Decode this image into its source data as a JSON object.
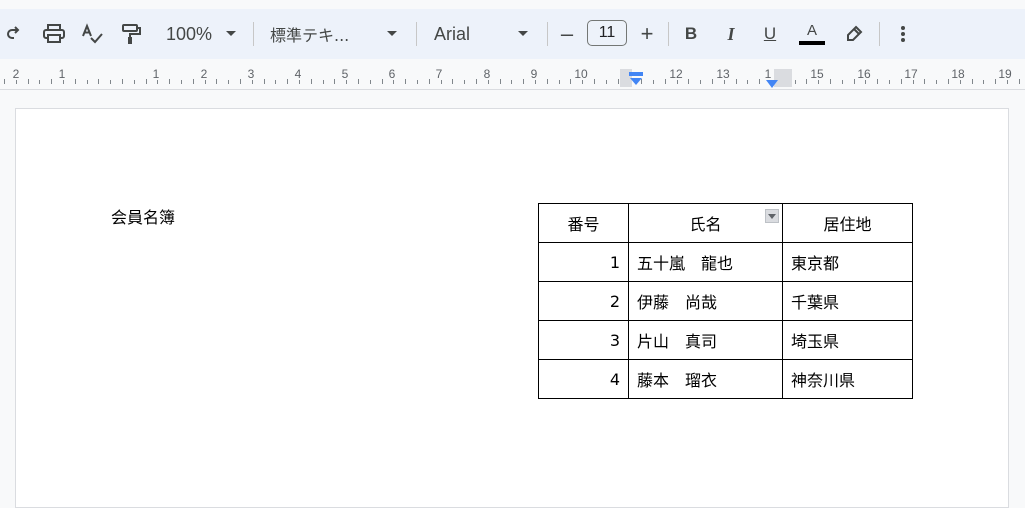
{
  "toolbar": {
    "redo_icon": "redo-icon",
    "print_icon": "print-icon",
    "spellcheck_icon": "spellcheck-icon",
    "paint_format_icon": "paint-format-icon",
    "zoom": "100%",
    "style": "標準テキ...",
    "font": "Arial",
    "decrease_size_label": "–",
    "font_size": "11",
    "increase_size_label": "+",
    "bold_label": "B",
    "italic_label": "I",
    "underline_label": "U",
    "text_color_label": "A",
    "text_color": "#000000",
    "highlight_icon": "highlight-pen-icon",
    "more_icon": "more-vert-icon"
  },
  "ruler": {
    "labels": [
      "2",
      "1",
      "1",
      "2",
      "3",
      "4",
      "5",
      "6",
      "7",
      "8",
      "9",
      "10",
      "12",
      "13",
      "1",
      "15",
      "16",
      "17",
      "18",
      "19"
    ]
  },
  "document": {
    "title": "会員名簿",
    "table": {
      "headers": [
        "番号",
        "氏名",
        "居住地"
      ],
      "rows": [
        [
          "1",
          "五十嵐　龍也",
          "東京都"
        ],
        [
          "2",
          "伊藤　尚哉",
          "千葉県"
        ],
        [
          "3",
          "片山　真司",
          "埼玉県"
        ],
        [
          "4",
          "藤本　瑠衣",
          "神奈川県"
        ]
      ]
    }
  },
  "colors": {
    "toolbar_bg": "#edf2fa",
    "indent_marker": "#4285f4"
  }
}
